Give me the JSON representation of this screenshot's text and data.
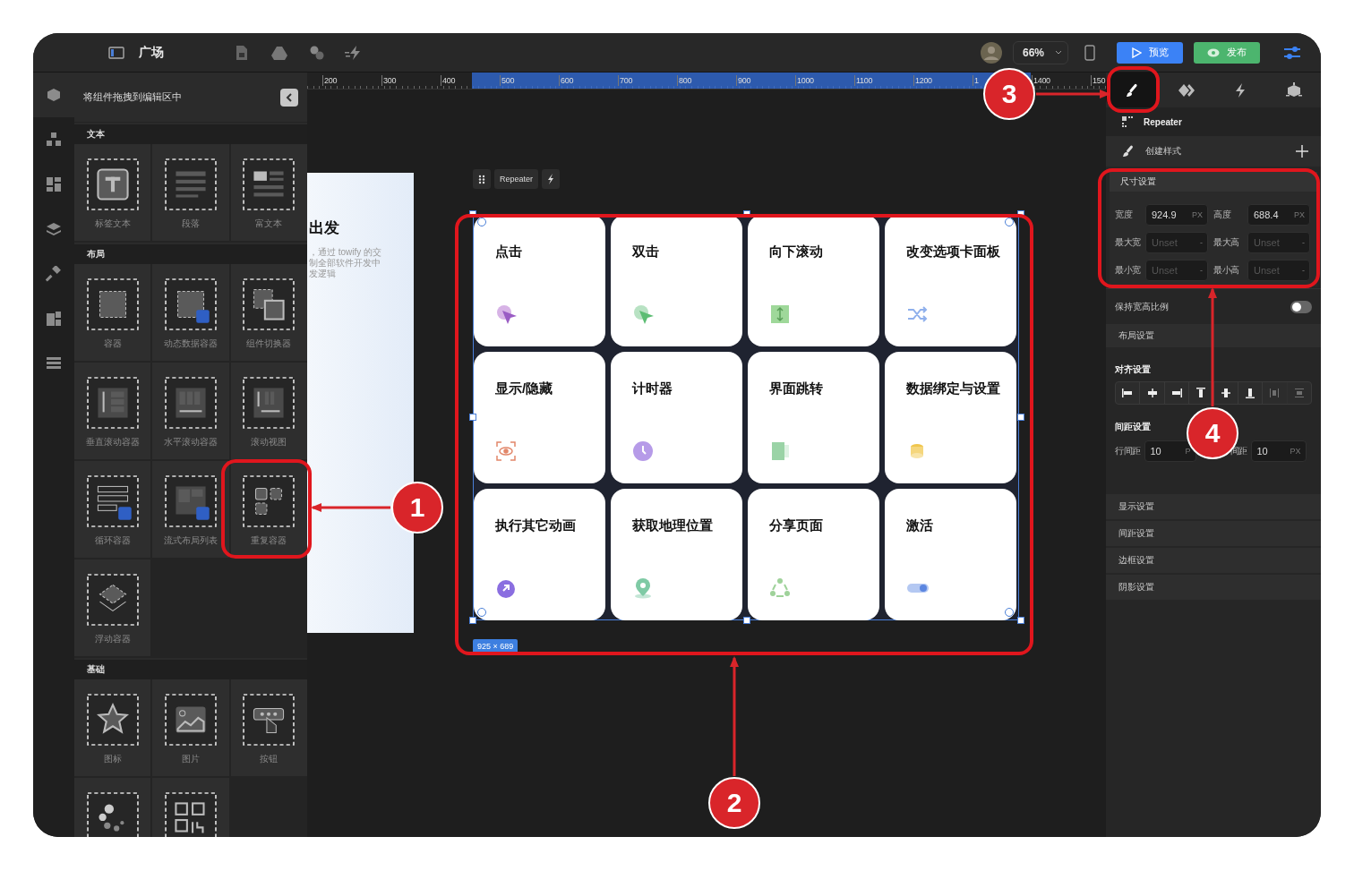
{
  "topbar": {
    "title": "广场",
    "zoom": "66%",
    "preview_button": "预览",
    "publish_button": "发布"
  },
  "rail": {
    "items": [
      {
        "selected": true
      },
      {
        "selected": false
      },
      {
        "selected": false
      },
      {
        "selected": false
      },
      {
        "selected": false
      },
      {
        "selected": false
      },
      {
        "selected": false
      }
    ]
  },
  "components": {
    "header": "将组件拖拽到编辑区中",
    "sections": [
      {
        "title": "文本",
        "items": [
          {
            "kind": "tile",
            "label": "标签文本"
          },
          {
            "kind": "tile",
            "label": "段落"
          },
          {
            "kind": "tile",
            "label": "富文本"
          }
        ]
      },
      {
        "title": "布局",
        "items": [
          {
            "kind": "tile",
            "label": "容器"
          },
          {
            "kind": "tile",
            "label": "动态数据容器"
          },
          {
            "kind": "tile",
            "label": "组件切换器"
          },
          {
            "kind": "tile",
            "label": "垂直滚动容器"
          },
          {
            "kind": "tile",
            "label": "水平滚动容器"
          },
          {
            "kind": "tile",
            "label": "滚动视图"
          },
          {
            "kind": "tile",
            "label": "循环容器"
          },
          {
            "kind": "tile",
            "label": "流式布局列表"
          },
          {
            "kind": "tile",
            "label": "重复容器"
          },
          {
            "kind": "tile",
            "label": "浮动容器"
          }
        ]
      },
      {
        "title": "基础",
        "items": [
          {
            "kind": "tile",
            "label": "图标"
          },
          {
            "kind": "tile",
            "label": "图片"
          },
          {
            "kind": "tile",
            "label": "按钮"
          },
          {
            "kind": "partial"
          },
          {
            "kind": "partial"
          }
        ]
      }
    ]
  },
  "ruler": {
    "labels": [
      "200",
      "300",
      "400",
      "500",
      "600",
      "700",
      "800",
      "900",
      "1000",
      "1100",
      "1200",
      "1",
      "1400",
      "150"
    ]
  },
  "canvas": {
    "preview_page": {
      "heading": "出发",
      "lines": [
        "，通过 towify 的交",
        "制全部软件开发中",
        "发逻辑"
      ]
    },
    "repeater": {
      "toolbar_label": "Repeater",
      "size": "925 × 689",
      "cards": [
        "点击",
        "双击",
        "向下滚动",
        "改变选项卡面板",
        "显示/隐藏",
        "计时器",
        "界面跳转",
        "数据绑定与设置",
        "执行其它动画",
        "获取地理位置",
        "分享页面",
        "激活"
      ]
    }
  },
  "inspector": {
    "tabs": [
      {
        "selected": true
      },
      {
        "selected": false
      },
      {
        "selected": false
      },
      {
        "selected": false
      }
    ],
    "component_name": "Repeater",
    "create_style": "创建样式",
    "size_section": {
      "title": "尺寸设置",
      "fields": [
        {
          "label": "宽度",
          "value": "924.9",
          "unit": "PX"
        },
        {
          "label": "高度",
          "value": "688.4",
          "unit": "PX"
        },
        {
          "label": "最大宽",
          "placeholder": "Unset",
          "unit": "-"
        },
        {
          "label": "最大高",
          "placeholder": "Unset",
          "unit": "-"
        },
        {
          "label": "最小宽",
          "placeholder": "Unset",
          "unit": "-"
        },
        {
          "label": "最小高",
          "placeholder": "Unset",
          "unit": "-"
        }
      ]
    },
    "keep_ratio": {
      "label": "保持宽高比例",
      "on": false
    },
    "layout_section": "布局设置",
    "align": {
      "label": "对齐设置",
      "buttons": [
        {
          "disabled": false
        },
        {
          "disabled": false
        },
        {
          "disabled": false
        },
        {
          "disabled": false
        },
        {
          "disabled": false
        },
        {
          "disabled": false
        },
        {
          "disabled": true
        },
        {
          "disabled": true
        }
      ]
    },
    "spacing": {
      "label": "间距设置",
      "fields": [
        {
          "label": "行间距",
          "value": "10",
          "unit": "P"
        },
        {
          "label": "间距",
          "value": "10",
          "unit": "PX"
        }
      ]
    },
    "sections": [
      "显示设置",
      "间距设置",
      "边框设置",
      "阴影设置"
    ]
  },
  "annotations": [
    {
      "label": "1"
    },
    {
      "label": "2"
    },
    {
      "label": "3"
    },
    {
      "label": "4"
    }
  ]
}
